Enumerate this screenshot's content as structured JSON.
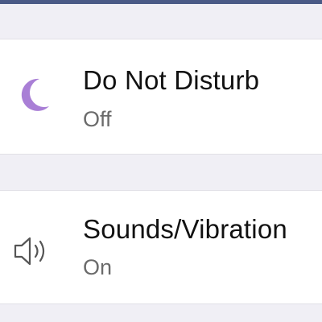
{
  "settings": {
    "items": [
      {
        "title": "Do Not Disturb",
        "status": "Off",
        "icon": "moon-icon",
        "icon_color": "#a97fd6"
      },
      {
        "title": "Sounds/Vibration",
        "status": "On",
        "icon": "speaker-icon",
        "icon_color": "#555555"
      }
    ]
  },
  "colors": {
    "header_bar": "#4a5a86",
    "background": "#f0eff5",
    "row_background": "#ffffff"
  }
}
